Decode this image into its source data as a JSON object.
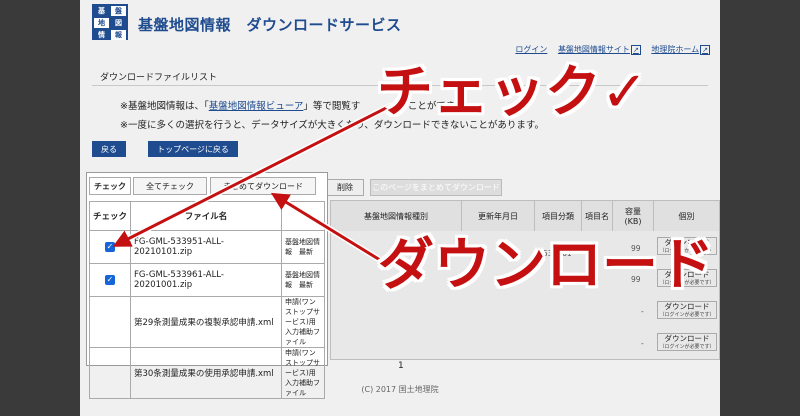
{
  "header": {
    "logo_chars": [
      "基",
      "盤",
      "地",
      "図",
      "情",
      "報"
    ],
    "site_title": "基盤地図情報　ダウンロードサービス",
    "links": [
      "ログイン",
      "基盤地図情報サイト",
      "地理院ホーム"
    ]
  },
  "section": {
    "title": "ダウンロードファイルリスト"
  },
  "notes": {
    "line1_prefix": "※基盤地図情報は、「",
    "line1_link": "基盤地図情報ビューア",
    "line1_suffix": "」等で閲覧す　　　　　ことができ",
    "line2": "※一度に多くの選択を行うと、データサイズが大きくなり、ダウンロードできないことがあります。"
  },
  "nav": {
    "back": "戻る",
    "top_page": "トップページに戻る"
  },
  "action_buttons": {
    "check": "チェック",
    "check_all": "全てチェック",
    "bulk_download": "まとめてダウンロード",
    "delete": "削除",
    "page_download": "このページをまとめてダウンロード"
  },
  "table": {
    "headers": [
      "チェック",
      "ファイル名",
      "基盤地図情報種別",
      "更新年月日",
      "項目分類",
      "項目名",
      "容量\n(KB)",
      "個別"
    ],
    "rows": [
      {
        "checked": true,
        "file": "FG-GML-533951-ALL-20210101.zip",
        "type": "基盤地図情報　最新",
        "date": "",
        "code": "",
        "item": "",
        "size": "99"
      },
      {
        "checked": true,
        "file": "FG-GML-533961-ALL-20201001.zip",
        "type": "基盤地図情報　最新",
        "date": "年10月0",
        "code": "533961",
        "item": "全",
        "size": "99"
      },
      {
        "checked": false,
        "file": "第29条測量成果の複製承認申請.xml",
        "type": "申請(ワンストップサービス)用入力補助ファイル",
        "date": "",
        "code": "",
        "item": "",
        "size": "-"
      },
      {
        "checked": false,
        "file": "第30条測量成果の使用承認申請.xml",
        "type": "申請(ワンストップサービス)用入力補助ファイル",
        "date": "",
        "code": "",
        "item": "",
        "size": "-"
      }
    ],
    "download_label": "ダウンロード",
    "login_required": "（ログインが必要です）"
  },
  "pagination": "1",
  "footer": "(C) 2017 国土地理院",
  "callouts": {
    "check": "チェック✓",
    "download": "ダウンロード"
  },
  "colors": {
    "brand": "#1f4c8f",
    "callout": "#c41010"
  }
}
